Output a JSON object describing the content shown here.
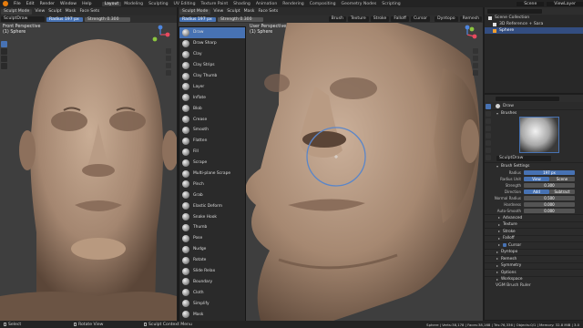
{
  "menu": {
    "items": [
      "File",
      "Edit",
      "Render",
      "Window",
      "Help"
    ],
    "workspaces": [
      "Layout",
      "Modeling",
      "Sculpting",
      "UV Editing",
      "Texture Paint",
      "Shading",
      "Animation",
      "Rendering",
      "Compositing",
      "Geometry Nodes",
      "Scripting"
    ],
    "active_workspace": "Layout",
    "scene": "Scene",
    "view_layer": "ViewLayer"
  },
  "left_view": {
    "mode": "Sculpt Mode",
    "menus": [
      "View",
      "Sculpt",
      "Mask",
      "Face Sets"
    ],
    "brush": "SculptDraw",
    "radius_label": "Radius",
    "radius_value": "197 px",
    "strength_label": "Strength",
    "strength_value": "0.300",
    "perspective": "Front Perspective",
    "object": "(1) Sphere"
  },
  "right_view": {
    "mode": "Sculpt Mode",
    "menus": [
      "View",
      "Sculpt",
      "Mask",
      "Face Sets"
    ],
    "radius_label": "Radius",
    "radius_value": "197 px",
    "strength_label": "Strength",
    "strength_value": "0.300",
    "dropdowns": [
      "Brush",
      "Texture",
      "Stroke",
      "Falloff",
      "Cursor"
    ],
    "dyntopo": "Dyntopo",
    "remesh": "Remesh",
    "perspective": "User Perspective",
    "object": "(1) Sphere"
  },
  "brushes": [
    "Draw",
    "Draw Sharp",
    "Clay",
    "Clay Strips",
    "Clay Thumb",
    "Layer",
    "Inflate",
    "Blob",
    "Crease",
    "Smooth",
    "Flatten",
    "Fill",
    "Scrape",
    "Multi-plane Scrape",
    "Pinch",
    "Grab",
    "Elastic Deform",
    "Snake Hook",
    "Thumb",
    "Pose",
    "Nudge",
    "Rotate",
    "Slide Relax",
    "Boundary",
    "Cloth",
    "Simplify",
    "Mask",
    "Draw Face Sets"
  ],
  "selected_brush": "Draw",
  "outliner": {
    "title": "Scene Collection",
    "items": [
      "3D Reference + Sara",
      "Sphere"
    ]
  },
  "properties": {
    "brushes_title": "Brushes",
    "brush_name": "SculptDraw",
    "brush_settings_title": "Brush Settings",
    "tool_name": "Draw",
    "settings": [
      {
        "label": "Radius",
        "value": "197 px"
      },
      {
        "label": "Radius Unit",
        "value": "View",
        "value2": "Scene"
      },
      {
        "label": "Strength",
        "value": "0.300"
      },
      {
        "label": "Direction",
        "value": "Add",
        "value2": "Subtract"
      },
      {
        "label": "Normal Radius",
        "value": "0.500"
      },
      {
        "label": "Hardness",
        "value": "0.000"
      },
      {
        "label": "Auto-Smooth",
        "value": "0.000"
      }
    ],
    "collapsed_panels": [
      "Advanced",
      "Texture",
      "Stroke",
      "Falloff",
      "Cursor",
      "Dyntopo",
      "Remesh",
      "Symmetry",
      "Options",
      "Workspace"
    ],
    "bottom_label": "VGM Brush Ruler"
  },
  "status": {
    "left": "Select",
    "middle": "Rotate View",
    "right_left": "Sculpt Context Menu",
    "stats": "Sphere | Verts:38,178 | Faces:38,168 | Tris:76,336 | Objects:0/1 | Memory: 32.8 MiB | 3.0"
  },
  "colors": {
    "accent": "#4772b3",
    "viewport": "#3e3e3e",
    "skin": "#a98b73"
  },
  "icons": [
    "blender-logo-icon",
    "axis-gizmo-icon",
    "zoom-icon",
    "hand-pan-icon",
    "camera-icon",
    "grid-icon",
    "brush-circle-cursor-icon"
  ]
}
